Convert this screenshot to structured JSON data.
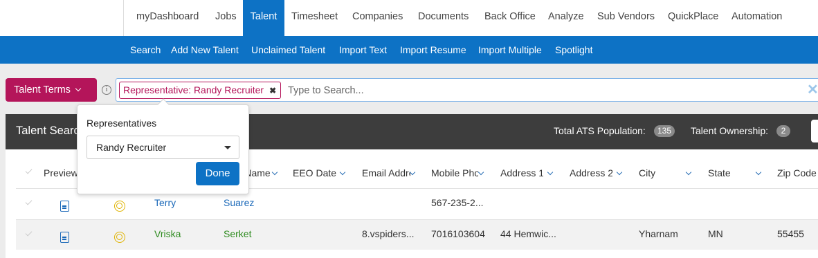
{
  "topnav": {
    "items": [
      {
        "label": "myDashboard"
      },
      {
        "label": "Jobs"
      },
      {
        "label": "Talent"
      },
      {
        "label": "Timesheet"
      },
      {
        "label": "Companies"
      },
      {
        "label": "Documents"
      },
      {
        "label": "Back Office"
      },
      {
        "label": "Analyze"
      },
      {
        "label": "Sub Vendors"
      },
      {
        "label": "QuickPlace"
      },
      {
        "label": "Automation"
      }
    ],
    "active": "Talent"
  },
  "subnav": {
    "items": [
      {
        "label": "Search"
      },
      {
        "label": "Add New Talent"
      },
      {
        "label": "Unclaimed Talent"
      },
      {
        "label": "Import Text"
      },
      {
        "label": "Import Resume"
      },
      {
        "label": "Import Multiple"
      },
      {
        "label": "Spotlight"
      }
    ]
  },
  "search": {
    "terms_button": "Talent Terms",
    "info_icon": "i",
    "chip": "Representative: Randy Recruiter",
    "chip_remove": "✖",
    "placeholder": "Type to Search...",
    "clear": "✕"
  },
  "panel": {
    "title": "Talent Search",
    "population_label": "Total ATS Population:",
    "population_count": "135",
    "ownership_label": "Talent Ownership:",
    "ownership_count": "2"
  },
  "table": {
    "columns": [
      {
        "label": "Preview"
      },
      {
        "label": "Last Name"
      },
      {
        "label": "EEO Date"
      },
      {
        "label": "Email Address"
      },
      {
        "label": "Mobile Phone"
      },
      {
        "label": "Address 1"
      },
      {
        "label": "Address 2"
      },
      {
        "label": "City"
      },
      {
        "label": "State"
      },
      {
        "label": "Zip Code"
      }
    ],
    "rows": [
      {
        "first": "Terry",
        "last": "Suarez",
        "email": "",
        "phone": "567-235-2...",
        "address1": "",
        "city": "",
        "state": "",
        "zip": ""
      },
      {
        "first": "Vriska",
        "last": "Serket",
        "email": "8.vspiders...",
        "phone": "7016103604",
        "address1": "44 Hemwic...",
        "city": "Yharnam",
        "state": "MN",
        "zip": "55455"
      }
    ]
  },
  "popover": {
    "label": "Representatives",
    "selected": "Randy Recruiter",
    "done": "Done"
  },
  "colors": {
    "primary_blue": "#0d72c5",
    "magenta": "#b4155a",
    "header_dark": "#3d3d3d"
  }
}
